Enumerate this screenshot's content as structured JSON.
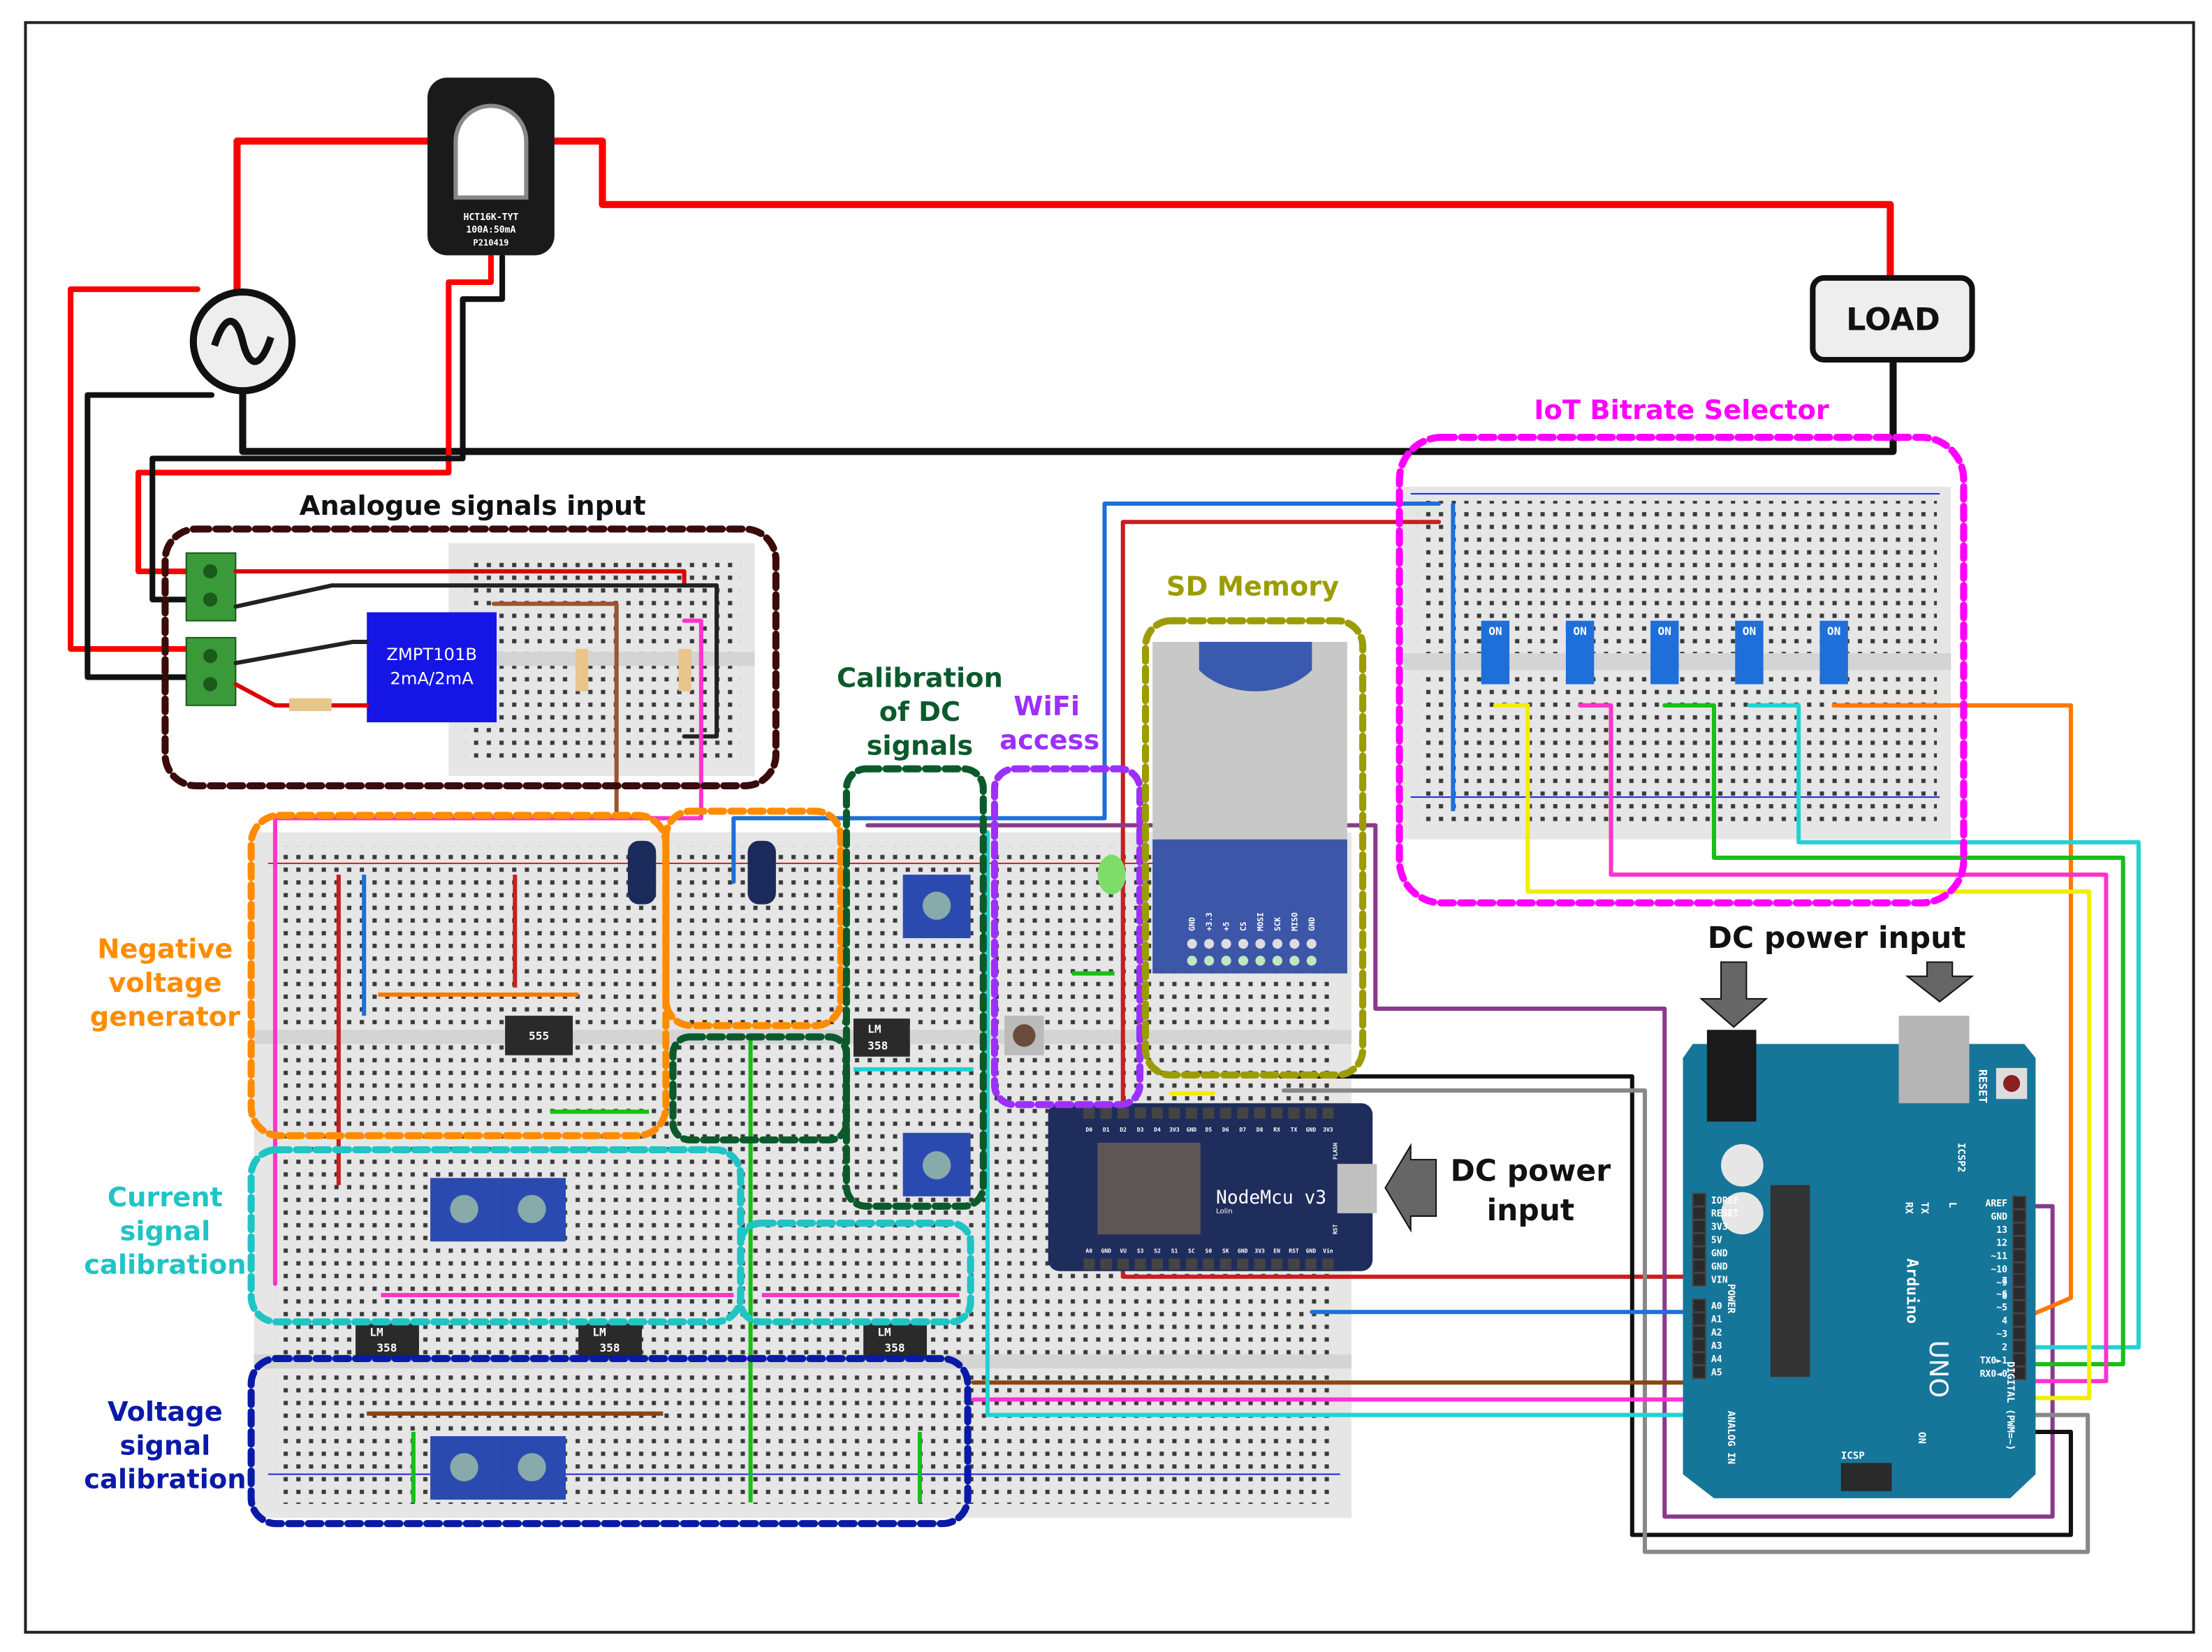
{
  "labels": {
    "analogue": "Analogue signals input",
    "iot": "IoT Bitrate Selector",
    "sd": "SD Memory",
    "calib_dc": [
      "Calibration",
      "of DC",
      "signals"
    ],
    "wifi": [
      "WiFi",
      "access"
    ],
    "neg_voltage": [
      "Negative",
      "voltage",
      "generator"
    ],
    "current_cal": [
      "Current",
      "signal",
      "calibration"
    ],
    "voltage_cal": [
      "Voltage",
      "signal",
      "calibration"
    ],
    "dc_power_arduino": "DC power input",
    "dc_power_nodemcu": [
      "DC power",
      "input"
    ]
  },
  "components": {
    "ct_sensor": [
      "HCT16K-TYT",
      "100A:50mA",
      "P210419"
    ],
    "load": "LOAD",
    "zmpt": [
      "ZMPT101B",
      "2mA/2mA"
    ],
    "ic_555": "555",
    "lm358": [
      "LM",
      "358"
    ],
    "dip_switch_on": "ON"
  },
  "nodemcu": {
    "title": "NodeMcu v3",
    "subtitle": "Lolin",
    "top_pins": [
      "D0",
      "D1",
      "D2",
      "D3",
      "D4",
      "3V3",
      "GND",
      "D5",
      "D6",
      "D7",
      "D8",
      "RX",
      "TX",
      "GND",
      "3V3"
    ],
    "bottom_pins": [
      "A0",
      "GND",
      "VU",
      "S3",
      "S2",
      "S1",
      "SC",
      "S0",
      "SK",
      "GND",
      "3V3",
      "EN",
      "RST",
      "GND",
      "Vin"
    ],
    "flash": "FLASH",
    "rst": "RST"
  },
  "sd_module": {
    "pins": [
      "GND",
      "+3.3",
      "+5",
      "CS",
      "MOSI",
      "SCK",
      "MISO",
      "GND"
    ]
  },
  "arduino": {
    "brand": "Arduino",
    "model": "UNO",
    "power_pins": [
      "IOREF",
      "RESET",
      "3V3",
      "5V",
      "GND",
      "GND",
      "VIN"
    ],
    "power_label": "POWER",
    "analog_pins": [
      "A0",
      "A1",
      "A2",
      "A3",
      "A4",
      "A5"
    ],
    "analog_label": "ANALOG IN",
    "digital_pins": [
      "AREF",
      "GND",
      "13",
      "12",
      "~11",
      "~10",
      "~9",
      "8",
      "7",
      "~6",
      "~5",
      "4",
      "~3",
      "2",
      "TX0►1",
      "RX0◄0"
    ],
    "digital_label": "DIGITAL (PWM=~)",
    "icsp": "ICSP",
    "icsp2": "ICSP2",
    "reset": "RESET",
    "rx": "RX",
    "tx": "TX",
    "l": "L",
    "on": "ON"
  },
  "colors": {
    "analogue": "#3b0b0b",
    "iot": "#ff00ff",
    "sd": "#9c9c00",
    "calib_dc": "#0b5a2c",
    "wifi": "#9b30ff",
    "neg_voltage": "#ff8c00",
    "current_cal": "#1fc4c4",
    "voltage_cal": "#0a1aa8"
  }
}
